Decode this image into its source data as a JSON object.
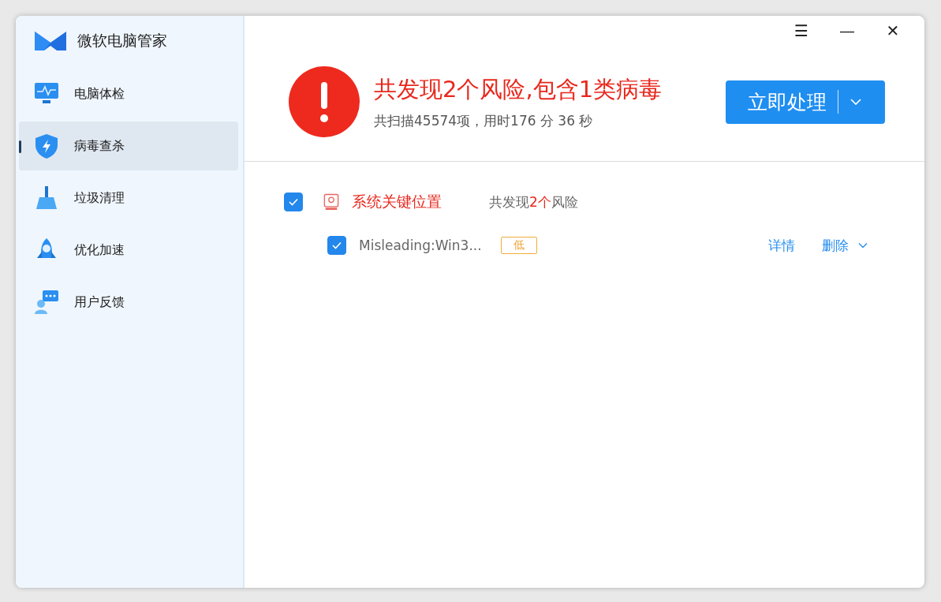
{
  "app": {
    "title": "微软电脑管家"
  },
  "sidebar": {
    "items": [
      {
        "label": "电脑体检",
        "selected": false
      },
      {
        "label": "病毒查杀",
        "selected": true
      },
      {
        "label": "垃圾清理",
        "selected": false
      },
      {
        "label": "优化加速",
        "selected": false
      },
      {
        "label": "用户反馈",
        "selected": false
      }
    ]
  },
  "window_controls": [
    "☰",
    "—",
    "✕"
  ],
  "result": {
    "headline": "共发现2个风险,包含1类病毒",
    "detail": "共扫描45574项，用时176 分 36  秒",
    "action": "立即处理"
  },
  "groups": [
    {
      "name": "系统关键位置",
      "checked": true,
      "summary": {
        "prefix": "共发现",
        "count": "2个",
        "suffix": "风险"
      },
      "threats": [
        {
          "name": "Misleading:Win3...",
          "checked": true,
          "level": "低",
          "links": [
            "详情",
            "删除"
          ]
        }
      ]
    }
  ]
}
